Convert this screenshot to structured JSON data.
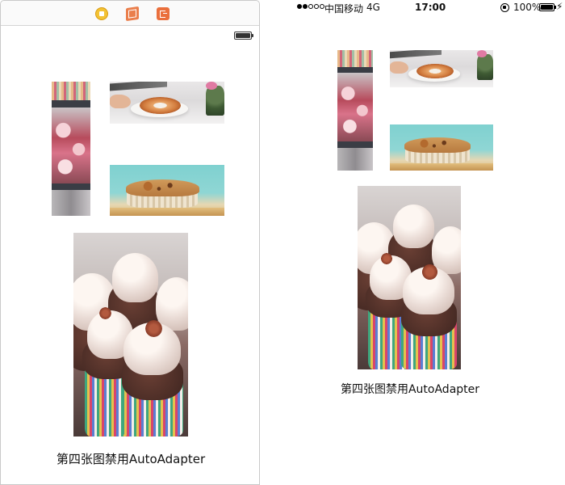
{
  "storyboard": {
    "dock_icons": [
      "view-controller-icon",
      "first-responder-icon",
      "exit-icon"
    ],
    "caption": "第四张图禁用AutoAdapter"
  },
  "device": {
    "status_bar": {
      "signal_dots": 5,
      "signal_filled": 2,
      "carrier": "中国移动",
      "network": "4G",
      "time": "17:00",
      "battery_percent": "100%",
      "battery_level": 1.0
    },
    "caption": "第四张图禁用AutoAdapter"
  },
  "images": [
    {
      "name": "cupcake-stand-image",
      "subject": "cupcake-stand"
    },
    {
      "name": "donut-hands-image",
      "subject": "donut-hands"
    },
    {
      "name": "muffin-image",
      "subject": "muffin"
    },
    {
      "name": "cupcakes-closeup-image",
      "subject": "cupcakes-closeup"
    }
  ],
  "colors": {
    "background": "#ffffff",
    "text": "#111111",
    "border": "#c9c9c9"
  }
}
